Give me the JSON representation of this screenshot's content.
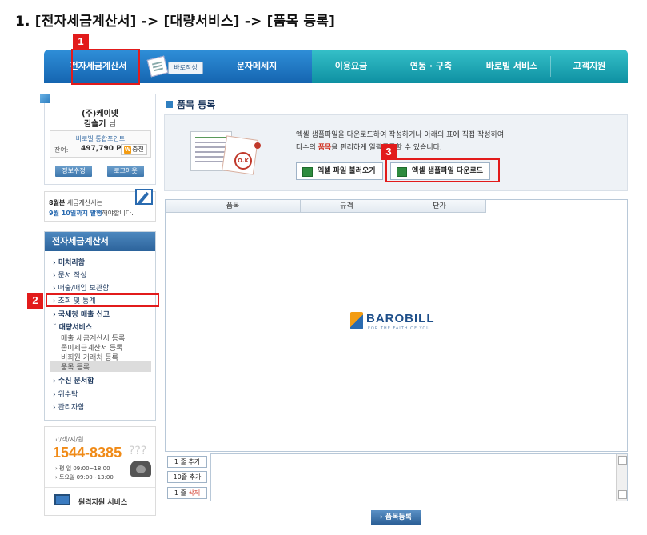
{
  "heading": "1. [전자세금계산서] -> [대량서비스] -> [품목 등록]",
  "nav": {
    "items": [
      "전자세금계산서",
      "문자메세지",
      "이용요금",
      "연동 · 구축",
      "바로빌 서비스",
      "고객지원"
    ],
    "baro_check": "바로작성"
  },
  "user": {
    "company": "(주)케이넷",
    "name": "김슬기",
    "honorific": "님",
    "point_title": "바로빌 통합포인트",
    "balance_label": "잔여:",
    "balance": "497,790 P",
    "charge_icon": "W",
    "charge": "충전",
    "btn_info": "정보수정",
    "btn_logout": "로그아웃"
  },
  "notice": {
    "l1_bold": "8월분",
    "l1_rest": " 세금계산서는",
    "l2_bold": "9월 10일까지 발행",
    "l2_rest": "해야합니다."
  },
  "menu": {
    "title": "전자세금계산서",
    "items": [
      {
        "label": "› 미처리함",
        "bold": true
      },
      {
        "label": "› 문서 작성",
        "bold": false
      },
      {
        "label": "› 매출/매입 보관함",
        "bold": false
      },
      {
        "label": "› 조회 및 통계",
        "bold": false
      },
      {
        "label": "› 국세청 매출 신고",
        "bold": true
      },
      {
        "label": "˅ 대량서비스",
        "bold": true
      }
    ],
    "sub": [
      "매출 세금계산서 등록",
      "종이세금계산서 등록",
      "비회원 거래처 등록",
      "품목 등록"
    ],
    "items2": [
      {
        "label": "› 수신 문서함",
        "bold": true
      },
      {
        "label": "› 위수탁",
        "bold": false
      },
      {
        "label": "› 관리자함",
        "bold": false
      }
    ]
  },
  "call": {
    "label": "고/객/지/원",
    "number": "1544-8385",
    "q": "???",
    "hours1": "› 평   일  09:00~18:00",
    "hours2": "› 토요일  09:00~13:00",
    "remote": "원격지원 서비스"
  },
  "main": {
    "title": "품목 등록",
    "info_l1": "엑셀 샘플파일을 다운로드하여 작성하거나 아래의 표에 직접 작성하여",
    "info_l2_a": "다수의 ",
    "info_l2_hl": "품목",
    "info_l2_b": "을 편리하게 일괄등록할 수 있습니다.",
    "stamp": "O.K",
    "btn_import": "엑셀 파일 불러오기",
    "btn_download": "엑셀 샘플파일 다운로드",
    "columns": [
      "품목",
      "규격",
      "단가"
    ],
    "logo": "BAROBILL",
    "logo_tag": "FOR THE FAITH OF YOU",
    "add1": "1 줄 추가",
    "add10": "10줄 추가",
    "del_pre": "1 줄 ",
    "del_red": "삭제",
    "submit": "› 품목등록"
  },
  "annotations": [
    "1",
    "2",
    "3"
  ],
  "colors": {
    "annotation": "#e21b1b",
    "nav_blue": "#1565b0",
    "nav_teal": "#0e90a2",
    "call_orange": "#f08a16"
  }
}
